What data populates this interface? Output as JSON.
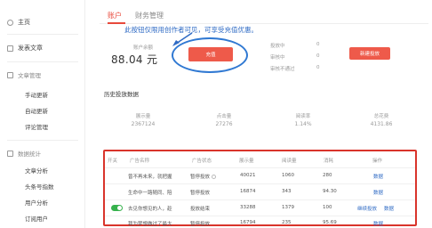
{
  "sidebar": {
    "home": "主页",
    "publish": "发表文章",
    "article_mgmt": {
      "title": "文章管理",
      "items": [
        "手动更新",
        "自动更新",
        "评论管理"
      ]
    },
    "data_stats": {
      "title": "数据统计",
      "items": [
        "文章分析",
        "头条号指数",
        "用户分析",
        "订阅用户"
      ]
    }
  },
  "tabs": [
    "账户",
    "财务管理"
  ],
  "annotation": "此按钮仅限用创作者可见，可享受充值优惠。",
  "account": {
    "available_label": "账户余额",
    "available_value": "88.04 元",
    "recharge_button": "充值"
  },
  "stats": [
    {
      "label": "投放中",
      "value": "0"
    },
    {
      "label": "审核中",
      "value": "0"
    },
    {
      "label": "审核不通过",
      "value": "0"
    }
  ],
  "new_campaign_button": "新建投放",
  "history": {
    "title": "历史投放数据",
    "headers": [
      "展示量",
      "点击量",
      "阅读率",
      "总花费"
    ],
    "values": [
      "2367124",
      "27276",
      "1.14%",
      "4131.86"
    ]
  },
  "table": {
    "headers": [
      "开关",
      "广告名称",
      "广告状态",
      "展示量",
      "阅读量",
      "消耗",
      "操作"
    ],
    "rows": [
      {
        "name": "曾不再未来，就把握",
        "status": "暂停投放",
        "impressions": "40021",
        "reads": "1060",
        "cost": "280",
        "actions": [
          "数据"
        ]
      },
      {
        "name": "生命中一路随同、陪",
        "status": "暂停投放",
        "impressions": "16874",
        "reads": "343",
        "cost": "94.30",
        "actions": [
          "数据"
        ]
      },
      {
        "name": "去见你想见的人，趁",
        "status": "投放结束",
        "impressions": "33288",
        "reads": "1379",
        "cost": "100",
        "actions": [
          "继续投放",
          "数据"
        ]
      },
      {
        "name": "我为梦想做过了最大",
        "status": "暂停投放",
        "impressions": "16794",
        "reads": "235",
        "cost": "95.69",
        "actions": [
          "数据"
        ]
      }
    ]
  },
  "colors": {
    "accent": "#e8493b",
    "button": "#ee5a4a",
    "annotation": "#2e6ac4",
    "ellipse": "#2f78d2",
    "table_border": "#d9342b",
    "toggle_on": "#37b24d"
  }
}
